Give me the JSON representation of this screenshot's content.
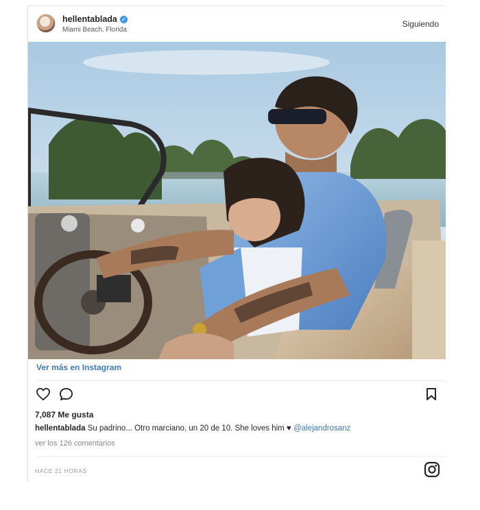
{
  "post": {
    "username": "hellentablada",
    "verified_mark": "✓",
    "location": "Miami Beach, Florida",
    "follow_label": "Siguiendo",
    "photo_icon": "photo",
    "view_more_label": "Ver más en Instagram",
    "likes": "7,087 Me gusta",
    "caption_user": "hellentablada",
    "caption_text": " Su padrino... Otro marciano, un 20 de 10. She loves him ",
    "caption_heart": "♥",
    "caption_mention": "@alejandrosanz",
    "comments_link": "ver los 126 comentarios",
    "timestamp": "HACE 21 HORAS"
  },
  "icons": {
    "like": "heart-outline-icon",
    "comment": "speech-bubble-icon",
    "save": "bookmark-icon",
    "brand": "instagram-icon"
  },
  "colors": {
    "link": "#3f7ab9",
    "verified": "#3897f0",
    "text": "#262626",
    "muted": "#999999"
  }
}
